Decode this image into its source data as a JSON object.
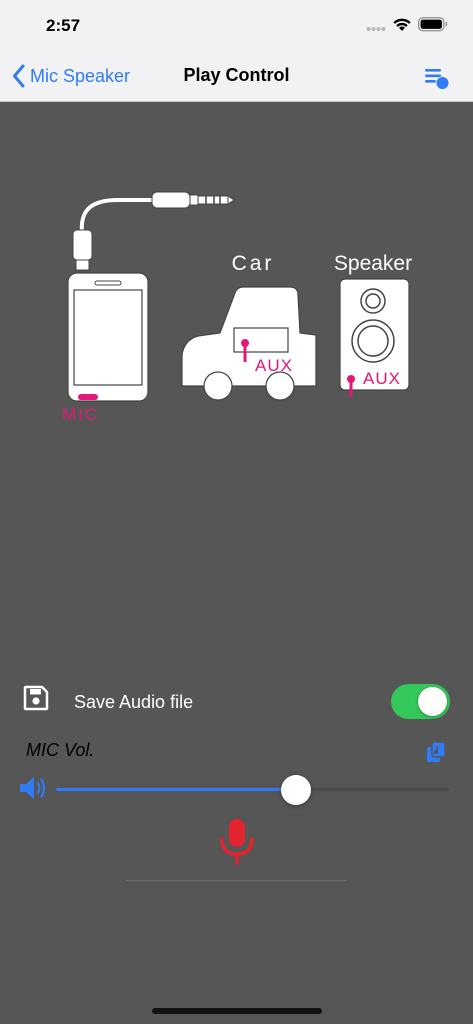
{
  "status_bar": {
    "time": "2:57"
  },
  "nav": {
    "back_label": "Mic Speaker",
    "title": "Play Control"
  },
  "illustration": {
    "car_label": "Car",
    "speaker_label": "Speaker",
    "mic_label": "MIC",
    "car_aux_label": "AUX",
    "speaker_aux_label": "AUX",
    "accent_color": "#e3177a"
  },
  "save_audio": {
    "label": "Save Audio file",
    "enabled": true
  },
  "mic_volume": {
    "label": "MIC Vol.",
    "level": 0.61
  },
  "colors": {
    "background": "#565656",
    "tint": "#2f7cf6",
    "toggle_on": "#34c759",
    "mic": "#e3232e"
  }
}
